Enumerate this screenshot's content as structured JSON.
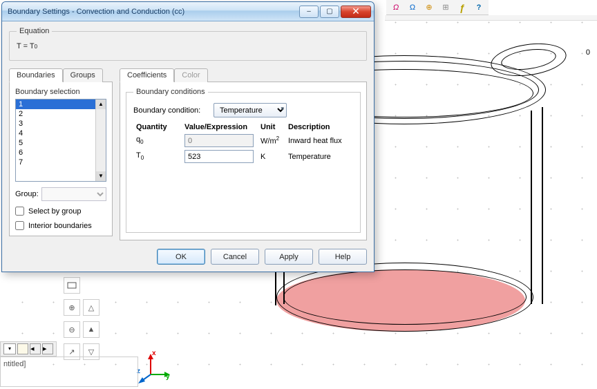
{
  "dialog": {
    "title": "Boundary Settings - Convection and Conduction (cc)",
    "equation_legend": "Equation",
    "equation_lhs": "T = T",
    "equation_sub": "0",
    "tabs_left": {
      "boundaries": "Boundaries",
      "groups": "Groups"
    },
    "boundary_selection_label": "Boundary selection",
    "boundaries": [
      "1",
      "2",
      "3",
      "4",
      "5",
      "6",
      "7"
    ],
    "group_label": "Group:",
    "select_by_group": "Select by group",
    "interior_boundaries": "Interior boundaries",
    "tabs_right": {
      "coefficients": "Coefficients",
      "color": "Color"
    },
    "bc_legend": "Boundary conditions",
    "bc_condition_label": "Boundary condition:",
    "bc_condition_value": "Temperature",
    "grid": {
      "headers": {
        "quantity": "Quantity",
        "value": "Value/Expression",
        "unit": "Unit",
        "desc": "Description"
      },
      "rows": [
        {
          "q_sym": "q",
          "q_sub": "0",
          "value": "0",
          "unit_main": "W/m",
          "unit_sup": "2",
          "desc": "Inward heat flux",
          "disabled": true
        },
        {
          "q_sym": "T",
          "q_sub": "0",
          "value": "523",
          "unit_main": "K",
          "unit_sup": "",
          "desc": "Temperature",
          "disabled": false
        }
      ]
    },
    "buttons": {
      "ok": "OK",
      "cancel": "Cancel",
      "apply": "Apply",
      "help": "Help"
    }
  },
  "status": {
    "doc": "ntitled]"
  },
  "axis": {
    "x": "x",
    "y": "y",
    "z": "z"
  },
  "canvas": {
    "zero": "0"
  },
  "top_icons": [
    "Ω",
    "Ω",
    "⊕",
    "⊞",
    "ƒ",
    "?"
  ]
}
